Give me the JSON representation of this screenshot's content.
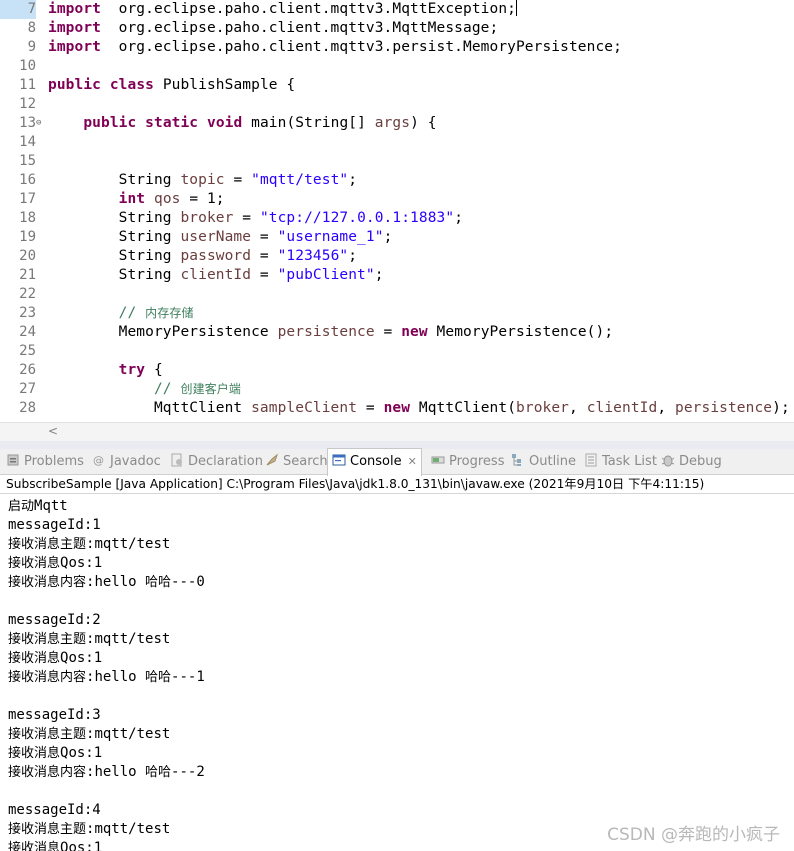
{
  "editor": {
    "lines": [
      {
        "n": "7",
        "segs": [
          [
            "kw",
            "import"
          ],
          [
            "",
            "  org.eclipse.paho.client.mqttv3.MqttException;"
          ]
        ]
      },
      {
        "n": "8",
        "segs": [
          [
            "kw",
            "import"
          ],
          [
            "",
            "  org.eclipse.paho.client.mqttv3.MqttMessage;"
          ]
        ]
      },
      {
        "n": "9",
        "segs": [
          [
            "kw",
            "import"
          ],
          [
            "",
            "  org.eclipse.paho.client.mqttv3.persist.MemoryPersistence;"
          ]
        ]
      },
      {
        "n": "10",
        "segs": []
      },
      {
        "n": "11",
        "segs": [
          [
            "kw",
            "public"
          ],
          [
            "",
            " "
          ],
          [
            "kw",
            "class"
          ],
          [
            "",
            " PublishSample {"
          ]
        ]
      },
      {
        "n": "12",
        "segs": []
      },
      {
        "n": "13",
        "segs": [
          [
            "",
            "    "
          ],
          [
            "kw",
            "public"
          ],
          [
            "",
            " "
          ],
          [
            "kw",
            "static"
          ],
          [
            "",
            " "
          ],
          [
            "kw",
            "void"
          ],
          [
            "",
            " main(String[] "
          ],
          [
            "var",
            "args"
          ],
          [
            "",
            ") {"
          ]
        ]
      },
      {
        "n": "14",
        "segs": []
      },
      {
        "n": "15",
        "segs": []
      },
      {
        "n": "16",
        "segs": [
          [
            "",
            "        String "
          ],
          [
            "var",
            "topic"
          ],
          [
            "",
            " = "
          ],
          [
            "str",
            "\"mqtt/test\""
          ],
          [
            "",
            ";"
          ]
        ]
      },
      {
        "n": "17",
        "segs": [
          [
            "",
            "        "
          ],
          [
            "kw",
            "int"
          ],
          [
            "",
            " "
          ],
          [
            "var",
            "qos"
          ],
          [
            "",
            " = 1;"
          ]
        ]
      },
      {
        "n": "18",
        "segs": [
          [
            "",
            "        String "
          ],
          [
            "var",
            "broker"
          ],
          [
            "",
            " = "
          ],
          [
            "str",
            "\"tcp://127.0.0.1:1883\""
          ],
          [
            "",
            ";"
          ]
        ]
      },
      {
        "n": "19",
        "segs": [
          [
            "",
            "        String "
          ],
          [
            "var",
            "userName"
          ],
          [
            "",
            " = "
          ],
          [
            "str",
            "\"username_1\""
          ],
          [
            "",
            ";"
          ]
        ]
      },
      {
        "n": "20",
        "segs": [
          [
            "",
            "        String "
          ],
          [
            "var",
            "password"
          ],
          [
            "",
            " = "
          ],
          [
            "str",
            "\"123456\""
          ],
          [
            "",
            ";"
          ]
        ]
      },
      {
        "n": "21",
        "segs": [
          [
            "",
            "        String "
          ],
          [
            "var",
            "clientId"
          ],
          [
            "",
            " = "
          ],
          [
            "str",
            "\"pubClient\""
          ],
          [
            "",
            ";"
          ]
        ]
      },
      {
        "n": "22",
        "segs": []
      },
      {
        "n": "23",
        "segs": [
          [
            "",
            "        "
          ],
          [
            "cm",
            "// "
          ],
          [
            "cm-cjk",
            "内存存储"
          ]
        ]
      },
      {
        "n": "24",
        "segs": [
          [
            "",
            "        MemoryPersistence "
          ],
          [
            "var",
            "persistence"
          ],
          [
            "",
            " = "
          ],
          [
            "kw",
            "new"
          ],
          [
            "",
            " MemoryPersistence();"
          ]
        ]
      },
      {
        "n": "25",
        "segs": []
      },
      {
        "n": "26",
        "segs": [
          [
            "",
            "        "
          ],
          [
            "kw",
            "try"
          ],
          [
            "",
            " {"
          ]
        ]
      },
      {
        "n": "27",
        "segs": [
          [
            "",
            "            "
          ],
          [
            "cm",
            "// "
          ],
          [
            "cm-cjk",
            "创建客户端"
          ]
        ]
      },
      {
        "n": "28",
        "segs": [
          [
            "",
            "            MqttClient "
          ],
          [
            "var",
            "sampleClient"
          ],
          [
            "",
            " = "
          ],
          [
            "kw",
            "new"
          ],
          [
            "",
            " MqttClient("
          ],
          [
            "var",
            "broker"
          ],
          [
            "",
            ", "
          ],
          [
            "var",
            "clientId"
          ],
          [
            "",
            ", "
          ],
          [
            "var",
            "persistence"
          ],
          [
            "",
            ");"
          ]
        ]
      }
    ]
  },
  "tabs": [
    {
      "label": "Problems",
      "icon": "problems-icon"
    },
    {
      "label": "Javadoc",
      "icon": "at-icon"
    },
    {
      "label": "Declaration",
      "icon": "declaration-icon"
    },
    {
      "label": "Search",
      "icon": "search-icon"
    },
    {
      "label": "Console",
      "icon": "console-icon",
      "active": true
    },
    {
      "label": "Progress",
      "icon": "progress-icon"
    },
    {
      "label": "Outline",
      "icon": "outline-icon"
    },
    {
      "label": "Task List",
      "icon": "task-list-icon"
    },
    {
      "label": "Debug",
      "icon": "debug-icon"
    }
  ],
  "console": {
    "header": "SubscribeSample [Java Application] C:\\Program Files\\Java\\jdk1.8.0_131\\bin\\javaw.exe (2021年9月10日 下午4:11:15)",
    "lines": [
      [
        [
          "cjk",
          "启动"
        ],
        [
          "",
          "Mqtt"
        ]
      ],
      [
        [
          "",
          "messageId:1"
        ]
      ],
      [
        [
          "cjk",
          "接收消息主题"
        ],
        [
          "",
          ":mqtt/test"
        ]
      ],
      [
        [
          "cjk",
          "接收消息"
        ],
        [
          "",
          "Qos:1"
        ]
      ],
      [
        [
          "cjk",
          "接收消息内容"
        ],
        [
          "",
          ":hello "
        ],
        [
          "cjk",
          "哈哈"
        ],
        [
          "",
          "---0"
        ]
      ],
      [],
      [
        [
          "",
          "messageId:2"
        ]
      ],
      [
        [
          "cjk",
          "接收消息主题"
        ],
        [
          "",
          ":mqtt/test"
        ]
      ],
      [
        [
          "cjk",
          "接收消息"
        ],
        [
          "",
          "Qos:1"
        ]
      ],
      [
        [
          "cjk",
          "接收消息内容"
        ],
        [
          "",
          ":hello "
        ],
        [
          "cjk",
          "哈哈"
        ],
        [
          "",
          "---1"
        ]
      ],
      [],
      [
        [
          "",
          "messageId:3"
        ]
      ],
      [
        [
          "cjk",
          "接收消息主题"
        ],
        [
          "",
          ":mqtt/test"
        ]
      ],
      [
        [
          "cjk",
          "接收消息"
        ],
        [
          "",
          "Qos:1"
        ]
      ],
      [
        [
          "cjk",
          "接收消息内容"
        ],
        [
          "",
          ":hello "
        ],
        [
          "cjk",
          "哈哈"
        ],
        [
          "",
          "---2"
        ]
      ],
      [],
      [
        [
          "",
          "messageId:4"
        ]
      ],
      [
        [
          "cjk",
          "接收消息主题"
        ],
        [
          "",
          ":mqtt/test"
        ]
      ],
      [
        [
          "cjk",
          "接收消息"
        ],
        [
          "",
          "Qos:1"
        ]
      ]
    ]
  },
  "watermark": "CSDN @奔跑的小疯子"
}
